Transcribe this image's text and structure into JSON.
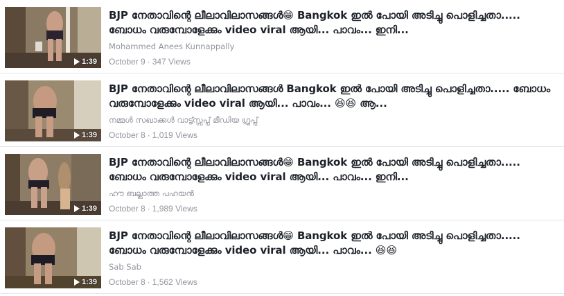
{
  "colors": {
    "title": "#1d2129",
    "secondary": "#90949c",
    "divider": "#e3e5e9",
    "thumb_bg": "#6b5a4a"
  },
  "videos": [
    {
      "title": "BJP നേതാവിന്റെ ലീലാവിലാസങ്ങൾ😁 Bangkok ഇൽ പോയി അടിച്ചു പൊളിച്ചതാ..... ബോധം വരുമ്പോളേക്കും video viral ആയി... പാവം... ഇനി...",
      "author": "Mohammed Anees Kunnappally",
      "date": "October 9",
      "views": "347 Views",
      "duration": "1:39",
      "play_icon": "play-icon"
    },
    {
      "title": "BJP നേതാവിന്റെ ലീലാവിലാസങ്ങൾ Bangkok ഇൽ പോയി അടിച്ചു പൊളിച്ചതാ..... ബോധം വരുമ്പോളേക്കും video viral ആയി... പാവം... 😆😆 ആ...",
      "author": "നമ്മൾ സഖാക്കൾ വാട്ട്സ്സപ്പ് മീഡിയ ഗ്രൂപ്പ്",
      "date": "October 8",
      "views": "1,019 Views",
      "duration": "1:39",
      "play_icon": "play-icon"
    },
    {
      "title": "BJP നേതാവിന്റെ ലീലാവിലാസങ്ങൾ😁 Bangkok ഇൽ പോയി അടിച്ചു പൊളിച്ചതാ..... ബോധം വരുമ്പോളേക്കും video viral ആയി... പാവം... ഇനി...",
      "author": "ഹൗ ബല്ലാത്ത പഹയൻ",
      "date": "October 8",
      "views": "1,989 Views",
      "duration": "1:39",
      "play_icon": "play-icon"
    },
    {
      "title": "BJP നേതാവിന്റെ ലീലാവിലാസങ്ങൾ😁 Bangkok ഇൽ പോയി അടിച്ചു പൊളിച്ചതാ..... ബോധം വരുമ്പോളേക്കും video viral ആയി... പാവം... 😆😆",
      "author": "Sab Sab",
      "date": "October 8",
      "views": "1,562 Views",
      "duration": "1:39",
      "play_icon": "play-icon"
    }
  ],
  "meta_separator": "·"
}
